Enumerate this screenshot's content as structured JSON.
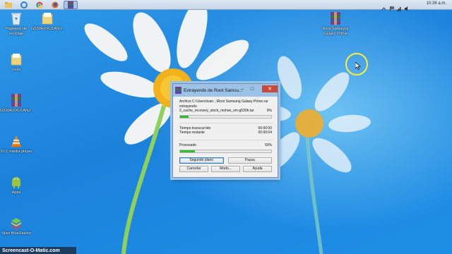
{
  "taskbar": {
    "clock": "10:36 a.m."
  },
  "desktop_icons": [
    {
      "name": "recycle-bin",
      "label": "Papelera de reciclaje",
      "icon": "recycle-bin-icon"
    },
    {
      "name": "folder-g530h",
      "label": "G530HXXU1ANJ...",
      "icon": "folder-icon"
    },
    {
      "name": "folder-roots",
      "label": "roots",
      "icon": "folder-icon"
    },
    {
      "name": "rar-g530h",
      "label": "G530HXXU1ANJ...",
      "icon": "winrar-icon"
    },
    {
      "name": "vlc",
      "label": "VLC media player",
      "icon": "vlc-icon"
    },
    {
      "name": "apps",
      "label": "Apps",
      "icon": "android-icon"
    },
    {
      "name": "bluestacks",
      "label": "Start BlueStacks",
      "icon": "bluestacks-icon"
    },
    {
      "name": "root-samsung",
      "label": "Root Samsung Galaxy Prime",
      "icon": "winrar-icon"
    }
  ],
  "dialog": {
    "title": "Extrayendo de Root Samsu...",
    "archive_line": "Archivo C:\\Users\\ivan...\\Root Samsung Galaxy Prime.rar",
    "action": "extrayendo",
    "file_name": "2_cache_recovery_stock_mohan_sm-g530h.tar",
    "file_percent": "9%",
    "file_progress": 0.09,
    "elapsed_label": "Tiempo transcurrido",
    "elapsed_value": "00:00:00",
    "remaining_label": "Tiempo restante",
    "remaining_value": "00:00:04",
    "processed_label": "Procesado",
    "processed_percent": "50%",
    "processed_progress": 0.16,
    "buttons": {
      "background": "Segundo plano",
      "pause": "Pausa",
      "cancel": "Cancelar",
      "mode": "Modo...",
      "help": "Ayuda"
    }
  },
  "watermark": "Screencast-O-Matic.com",
  "colors": {
    "progress_green": "#2fbd31",
    "title_bar": "#9cc3e7",
    "close_red": "#c94a3a"
  }
}
